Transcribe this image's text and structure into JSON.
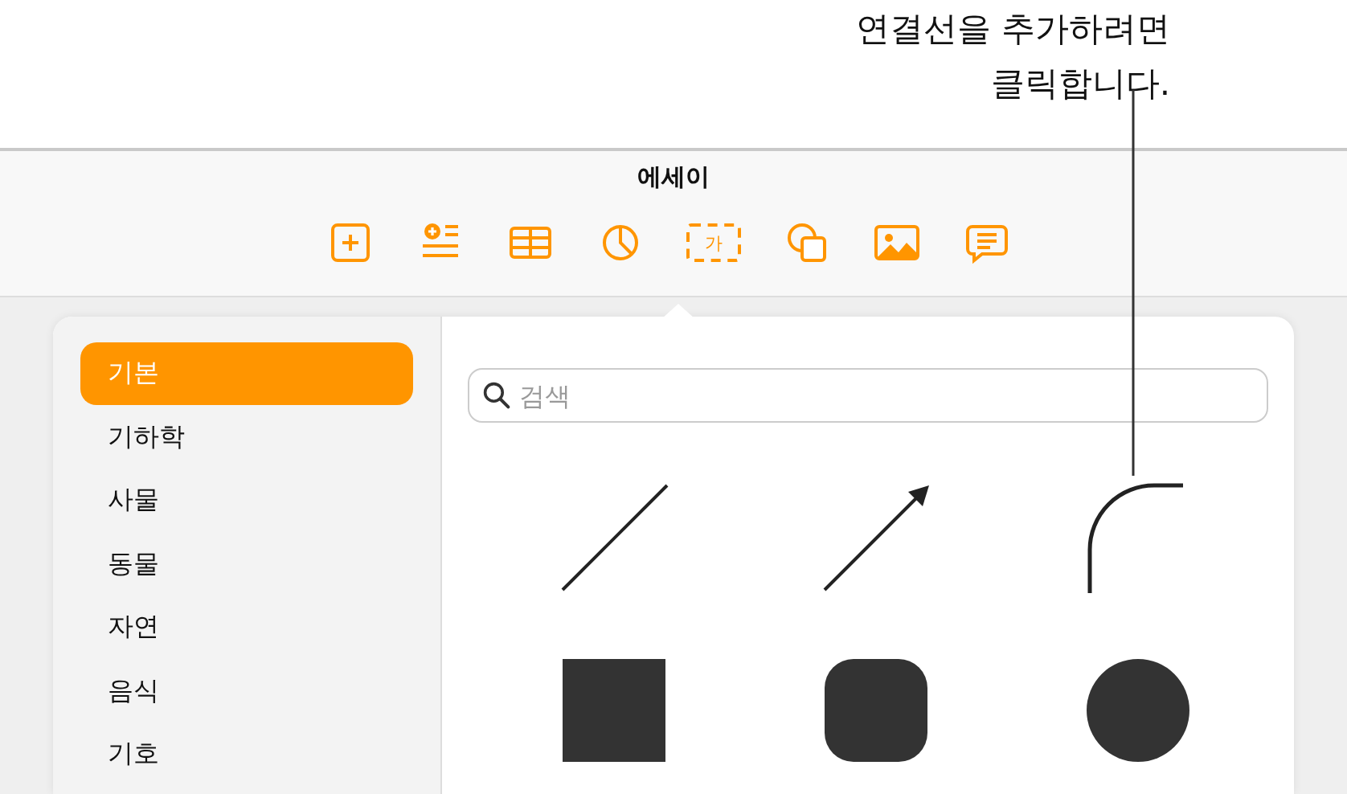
{
  "callout": {
    "text": "연결선을 추가하려면\n클릭합니다."
  },
  "window": {
    "title": "에세이"
  },
  "toolbar": [
    {
      "kind": "add"
    },
    {
      "kind": "list"
    },
    {
      "kind": "table"
    },
    {
      "kind": "chart"
    },
    {
      "kind": "textbox",
      "label": "가"
    },
    {
      "kind": "shape"
    },
    {
      "kind": "media"
    },
    {
      "kind": "comment"
    }
  ],
  "sidebar": {
    "items": [
      {
        "label": "기본",
        "selected": true
      },
      {
        "label": "기하학",
        "selected": false
      },
      {
        "label": "사물",
        "selected": false
      },
      {
        "label": "동물",
        "selected": false
      },
      {
        "label": "자연",
        "selected": false
      },
      {
        "label": "음식",
        "selected": false
      },
      {
        "label": "기호",
        "selected": false
      }
    ]
  },
  "search": {
    "placeholder": "검색"
  },
  "shapes": [
    {
      "kind": "line"
    },
    {
      "kind": "arrow"
    },
    {
      "kind": "curve"
    },
    {
      "kind": "square"
    },
    {
      "kind": "rounded-square"
    },
    {
      "kind": "circle"
    }
  ]
}
